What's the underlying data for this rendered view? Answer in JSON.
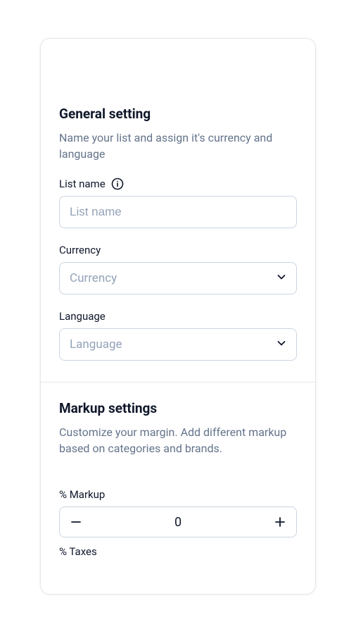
{
  "general": {
    "title": "General setting",
    "subtitle": "Name your list and assign it's currency and language",
    "listName": {
      "label": "List name",
      "placeholder": "List name",
      "value": ""
    },
    "currency": {
      "label": "Currency",
      "placeholder": "Currency"
    },
    "language": {
      "label": "Language",
      "placeholder": "Language"
    }
  },
  "markup": {
    "title": "Markup settings",
    "subtitle": "Customize your margin. Add different markup based on categories and brands.",
    "percentMarkup": {
      "label": "% Markup",
      "value": "0"
    },
    "percentTaxes": {
      "label": "% Taxes"
    }
  }
}
